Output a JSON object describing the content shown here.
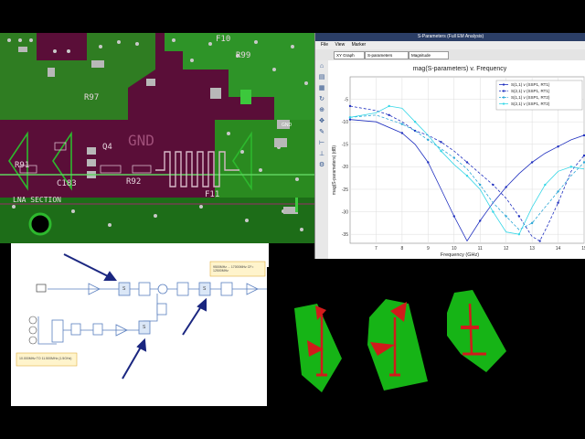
{
  "pcb": {
    "labels": {
      "lna_section": "LNA SECTION",
      "gnd_large": "GND",
      "r91": "R91",
      "r92": "R92",
      "r97": "R97",
      "c183": "C183",
      "q4": "Q4",
      "f11": "F11",
      "f10": "F10",
      "r99": "R99",
      "gnd_small": "GND"
    }
  },
  "sim": {
    "window_title": "S-Parameters (Full EM Analysis)",
    "menu": [
      "File",
      "View",
      "Marker"
    ],
    "toolbar": {
      "graph_type": "XY Graph",
      "param_type": "S-parameters",
      "format": "Magnitude"
    },
    "side_tools": [
      "home-icon",
      "print-icon",
      "grid-icon",
      "refresh-icon",
      "zoom-icon",
      "pan-icon",
      "marker-icon",
      "ruler-icon",
      "axis-icon",
      "settings-icon"
    ],
    "colors": {
      "series_1": "#1f2fbf",
      "series_2": "#2aa6d6",
      "series_3": "#33d6e6"
    }
  },
  "chart_data": {
    "type": "line",
    "title": "mag(S-parameters) v. Frequency",
    "xlabel": "Frequency (GHz)",
    "ylabel": "mag(S-parameters) (dB)",
    "xlim": [
      6,
      15
    ],
    "ylim": [
      -37,
      0
    ],
    "xticks": [
      "7",
      "8",
      "9",
      "10",
      "11",
      "12",
      "13",
      "14",
      "15"
    ],
    "yticks": [
      "-5",
      "-10",
      "-15",
      "-20",
      "-25",
      "-30",
      "-35"
    ],
    "grid": true,
    "legend_position": "top-right",
    "series": [
      {
        "name": "S(1,1) v (SSP1, RT1)",
        "color": "#1f2fbf",
        "dash": false,
        "x": [
          6.0,
          7.0,
          8.0,
          8.5,
          9.0,
          9.5,
          10.0,
          10.5,
          11.0,
          11.5,
          12.0,
          12.5,
          13.0,
          13.5,
          14.0,
          14.5,
          15.0
        ],
        "y": [
          -9.5,
          -10.0,
          -12.5,
          -15.0,
          -19.0,
          -25.0,
          -31.0,
          -36.5,
          -32.0,
          -28.0,
          -24.5,
          -21.5,
          -19.0,
          -17.0,
          -15.5,
          -14.0,
          -13.0
        ]
      },
      {
        "name": "S(2,1) v (SSP1, RT1)",
        "color": "#1f2fbf",
        "dash": true,
        "x": [
          6.0,
          7.0,
          7.5,
          8.0,
          8.5,
          9.0,
          9.5,
          10.0,
          10.5,
          11.0,
          11.5,
          12.0,
          12.5,
          13.0,
          13.3,
          13.6,
          14.0,
          14.5,
          15.0
        ],
        "y": [
          -6.5,
          -7.5,
          -8.5,
          -10.0,
          -12.0,
          -13.0,
          -14.5,
          -16.5,
          -19.0,
          -21.5,
          -24.0,
          -27.0,
          -31.0,
          -35.5,
          -36.5,
          -33.0,
          -28.0,
          -21.0,
          -17.5
        ]
      },
      {
        "name": "S(1,1) v (SSP1, RT2)",
        "color": "#2aa6d6",
        "dash": true,
        "x": [
          6.0,
          7.0,
          8.0,
          8.5,
          9.0,
          9.5,
          10.0,
          10.5,
          11.0,
          11.5,
          12.0,
          12.5,
          13.0,
          13.5,
          14.0,
          14.5,
          15.0
        ],
        "y": [
          -9.0,
          -8.5,
          -10.5,
          -12.0,
          -14.0,
          -16.0,
          -18.0,
          -20.5,
          -24.0,
          -28.0,
          -31.0,
          -34.0,
          -32.5,
          -29.0,
          -25.5,
          -22.0,
          -19.0
        ]
      },
      {
        "name": "S(2,1) v (SSP1, RT2)",
        "color": "#33d6e6",
        "dash": false,
        "x": [
          6.0,
          7.0,
          7.5,
          8.0,
          8.5,
          9.0,
          9.5,
          10.0,
          10.5,
          11.0,
          11.5,
          12.0,
          12.5,
          13.0,
          13.5,
          14.0,
          14.5,
          15.0
        ],
        "y": [
          -9.0,
          -8.0,
          -6.5,
          -7.0,
          -10.0,
          -13.0,
          -16.5,
          -19.5,
          -22.0,
          -25.0,
          -30.0,
          -34.5,
          -35.0,
          -29.0,
          -24.0,
          -21.0,
          -20.0,
          -20.5
        ]
      }
    ]
  },
  "block_diagram": {
    "note": "10.000MHz TO 11.500MHz  (1.5GHz)",
    "freq_label": "9500MHz ... 17000MHz  CF= 12500MHz",
    "switch_label": "S"
  }
}
